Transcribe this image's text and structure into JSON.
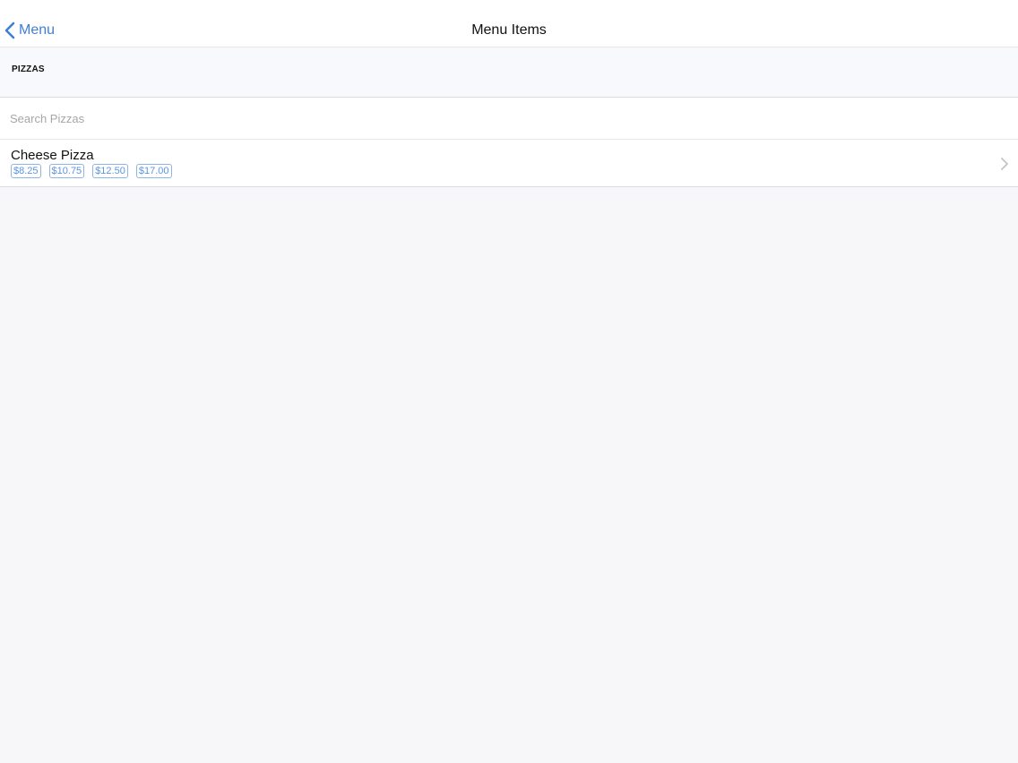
{
  "navbar": {
    "back_label": "Menu",
    "title": "Menu Items",
    "icons": {
      "back": "chevron-left-icon"
    }
  },
  "section": {
    "title": "PIZZAS"
  },
  "search": {
    "placeholder": "Search Pizzas",
    "value": ""
  },
  "items": [
    {
      "name": "Cheese Pizza",
      "prices": [
        "$8.25",
        "$10.75",
        "$12.50",
        "$17.00"
      ],
      "icon": "chevron-right-icon"
    }
  ],
  "colors": {
    "accent": "#3f7fd6",
    "price_text": "#5c95dd",
    "price_border": "#8fb5e6",
    "background": "#f7f7f9"
  }
}
